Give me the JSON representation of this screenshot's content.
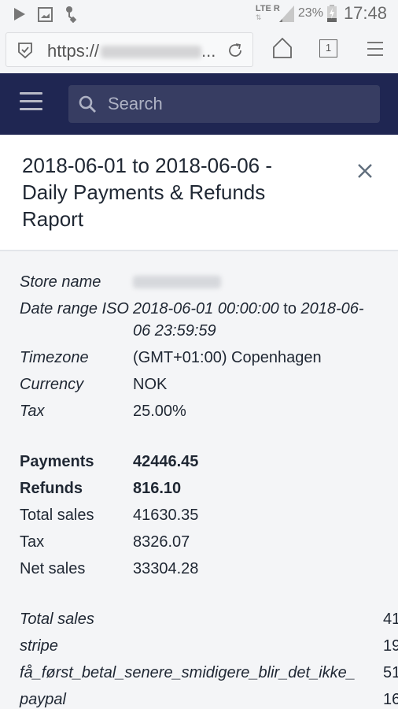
{
  "status_bar": {
    "left_icons": [
      "play-store-icon",
      "gallery-icon",
      "usb-debug-icon"
    ],
    "network_label": "LTE R",
    "battery_percent": "23%",
    "time": "17:48"
  },
  "browser": {
    "url_prefix": "https://",
    "url_ellipsis": "...",
    "tab_count": "1"
  },
  "header": {
    "search_placeholder": "Search"
  },
  "report": {
    "title": "2018-06-01 to 2018-06-06 - Daily Payments & Refunds Raport",
    "info": [
      {
        "label": "Store name",
        "value": ""
      },
      {
        "label": "Date range ISO",
        "value_start": "2018-06-01 00:00:00",
        "value_mid": " to ",
        "value_end": "2018-06-06 23:59:59"
      },
      {
        "label": "Timezone",
        "value": "(GMT+01:00) Copenhagen"
      },
      {
        "label": "Currency",
        "value": "NOK"
      },
      {
        "label": "Tax",
        "value": "25.00%"
      }
    ],
    "totals": [
      {
        "label": "Payments",
        "value": "42446.45"
      },
      {
        "label": "Refunds",
        "value": "816.10"
      },
      {
        "label": "Total sales",
        "value": "41630.35"
      },
      {
        "label": "Tax",
        "value": "8326.07"
      },
      {
        "label": "Net sales",
        "value": "33304.28"
      }
    ],
    "methods": [
      {
        "label": "Total sales",
        "value": "41"
      },
      {
        "label": "stripe",
        "value": "19"
      },
      {
        "label": "få_først_betal_senere_smidigere_blir_det_ikke_",
        "value": "51"
      },
      {
        "label": "paypal",
        "value": "16"
      }
    ]
  }
}
